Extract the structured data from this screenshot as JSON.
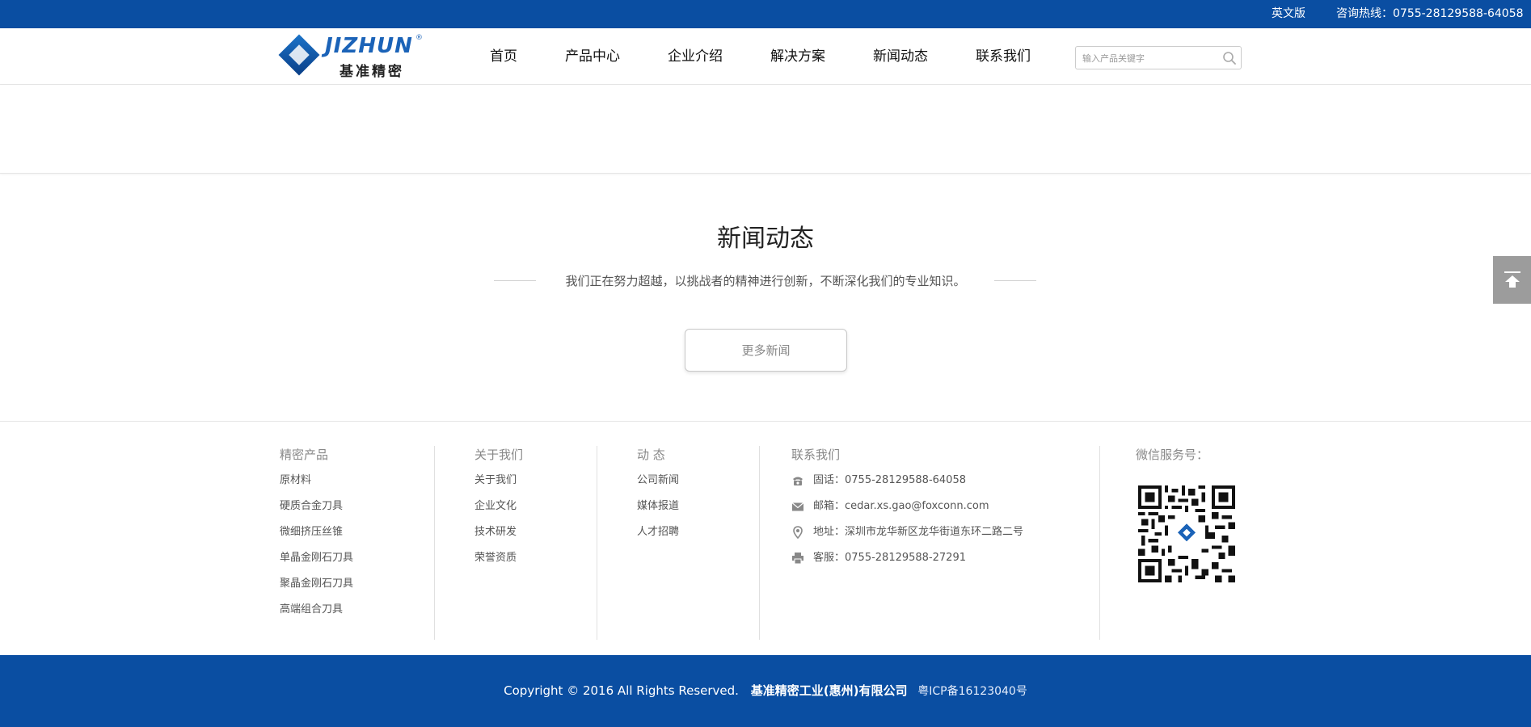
{
  "topbar": {
    "lang_label": "英文版",
    "hotline": "咨询热线：0755-28129588-64058"
  },
  "logo": {
    "brand": "JIZHUN",
    "brand_sub": "基准精密",
    "reg": "®"
  },
  "nav": {
    "items": [
      "首页",
      "产品中心",
      "企业介绍",
      "解决方案",
      "新闻动态",
      "联系我们"
    ]
  },
  "search": {
    "placeholder": "输入产品关键字"
  },
  "news": {
    "title": "新闻动态",
    "subtitle": "我们正在努力超越，以挑战者的精神进行创新，不断深化我们的专业知识。",
    "more_label": "更多新闻"
  },
  "footer": {
    "products": {
      "heading": "精密产品",
      "links": [
        "原材料",
        "硬质合金刀具",
        "微细挤压丝锥",
        "单晶金刚石刀具",
        "聚晶金刚石刀具",
        "高端组合刀具"
      ]
    },
    "about": {
      "heading": "关于我们",
      "links": [
        "关于我们",
        "企业文化",
        "技术研发",
        "荣誉资质"
      ]
    },
    "dynamic": {
      "heading": "动 态",
      "links": [
        "公司新闻",
        "媒体报道",
        "人才招聘"
      ]
    },
    "contact": {
      "heading": "联系我们",
      "phone": "固话：0755-28129588-64058",
      "email": "邮箱：cedar.xs.gao@foxconn.com",
      "address": "地址：深圳市龙华新区龙华街道东环二路二号",
      "service": "客服：0755-28129588-27291"
    },
    "wechat": {
      "heading": "微信服务号："
    }
  },
  "bottom": {
    "copyright": "Copyright ©  2016    All Rights Reserved.",
    "company": "基准精密工业(惠州)有限公司",
    "icp": "粤ICP备16123040号"
  },
  "colors": {
    "brand_blue": "#0a4ea2",
    "totop_gray": "#9c9c9c"
  },
  "icons": [
    "search-icon",
    "back-to-top-icon",
    "phone-icon",
    "mail-icon",
    "location-icon",
    "printer-icon",
    "qr-code"
  ]
}
